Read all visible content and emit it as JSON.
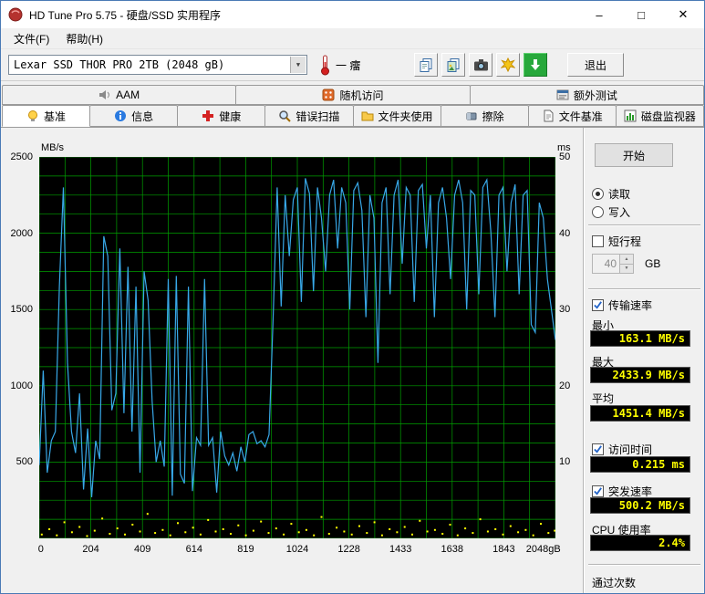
{
  "window": {
    "title": "HD Tune Pro 5.75 - 硬盘/SSD 实用程序",
    "minimize_glyph": "–",
    "maximize_glyph": "□",
    "close_glyph": "✕"
  },
  "menu": {
    "file": "文件(F)",
    "help": "帮助(H)"
  },
  "toolbar": {
    "device": "Lexar SSD THOR PRO 2TB (2048 gB)",
    "combo_arrow": "▼",
    "temperature": "一 癅",
    "exit_label": "退出"
  },
  "icons": {
    "spin_up": "▲",
    "spin_down": "▼"
  },
  "tabs": {
    "row1": [
      {
        "label": "AAM"
      },
      {
        "label": "随机访问"
      },
      {
        "label": "额外测试"
      }
    ],
    "row2": [
      {
        "label": "基准"
      },
      {
        "label": "信息"
      },
      {
        "label": "健康"
      },
      {
        "label": "错误扫描"
      },
      {
        "label": "文件夹使用"
      },
      {
        "label": "擦除"
      },
      {
        "label": "文件基准"
      },
      {
        "label": "磁盘监视器"
      }
    ]
  },
  "panel": {
    "start_label": "开始",
    "read_label": "读取",
    "write_label": "写入",
    "short_stroke_label": "短行程",
    "short_stroke_value": "40",
    "short_stroke_unit": "GB",
    "transfer_label": "传输速率",
    "min_label": "最小",
    "min_value": "163.1 MB/s",
    "max_label": "最大",
    "max_value": "2433.9 MB/s",
    "avg_label": "平均",
    "avg_value": "1451.4 MB/s",
    "access_label": "访问时间",
    "access_value": "0.215 ms",
    "burst_label": "突发速率",
    "burst_value": "500.2 MB/s",
    "cpu_label": "CPU 使用率",
    "cpu_value": "2.4%",
    "pass_label": "通过次数"
  },
  "colors": {
    "value_box_bg": "#000000",
    "value_box_text": "#ffff00",
    "chart_bg": "#000000",
    "grid_green": "#00a000",
    "transfer_line_blue": "#38a8e8",
    "access_dot_yellow": "#ffff00"
  },
  "chart_data": {
    "type": "line",
    "title": "",
    "left_axis": {
      "label": "MB/s",
      "min": 0,
      "max": 2500,
      "ticks": [
        500,
        1000,
        1500,
        2000,
        2500
      ]
    },
    "right_axis": {
      "label": "ms",
      "min": 0,
      "max": 50,
      "ticks": [
        10,
        20,
        30,
        40,
        50
      ]
    },
    "x_axis": {
      "min": 0,
      "max": 2048,
      "unit": "GB",
      "tick_labels": [
        "0",
        "204",
        "409",
        "614",
        "819",
        "1024",
        "1228",
        "1433",
        "1638",
        "1843",
        "2048gB"
      ]
    },
    "grid": {
      "color": "#00a000",
      "bg": "#000000",
      "x_divisions": 20,
      "y_divisions": 20
    },
    "legend": "none",
    "series": [
      {
        "name": "transfer_rate",
        "unit": "MB/s",
        "color": "#38a8e8",
        "style": "line",
        "points": [
          [
            0,
            480
          ],
          [
            16,
            1100
          ],
          [
            32,
            430
          ],
          [
            48,
            640
          ],
          [
            64,
            700
          ],
          [
            80,
            1650
          ],
          [
            96,
            2300
          ],
          [
            112,
            1150
          ],
          [
            128,
            700
          ],
          [
            144,
            560
          ],
          [
            160,
            950
          ],
          [
            176,
            320
          ],
          [
            192,
            720
          ],
          [
            208,
            270
          ],
          [
            224,
            640
          ],
          [
            240,
            520
          ],
          [
            256,
            1980
          ],
          [
            272,
            1850
          ],
          [
            288,
            840
          ],
          [
            304,
            950
          ],
          [
            320,
            1900
          ],
          [
            336,
            820
          ],
          [
            352,
            1780
          ],
          [
            368,
            700
          ],
          [
            384,
            1650
          ],
          [
            400,
            430
          ],
          [
            416,
            1750
          ],
          [
            432,
            1560
          ],
          [
            448,
            900
          ],
          [
            464,
            500
          ],
          [
            480,
            640
          ],
          [
            496,
            470
          ],
          [
            512,
            1700
          ],
          [
            528,
            280
          ],
          [
            544,
            1720
          ],
          [
            560,
            420
          ],
          [
            576,
            360
          ],
          [
            592,
            1650
          ],
          [
            608,
            310
          ],
          [
            624,
            660
          ],
          [
            640,
            610
          ],
          [
            656,
            1700
          ],
          [
            672,
            610
          ],
          [
            688,
            660
          ],
          [
            704,
            300
          ],
          [
            720,
            700
          ],
          [
            736,
            540
          ],
          [
            752,
            480
          ],
          [
            768,
            560
          ],
          [
            784,
            440
          ],
          [
            800,
            600
          ],
          [
            816,
            500
          ],
          [
            832,
            680
          ],
          [
            848,
            700
          ],
          [
            864,
            620
          ],
          [
            880,
            640
          ],
          [
            896,
            600
          ],
          [
            912,
            680
          ],
          [
            928,
            1450
          ],
          [
            944,
            2300
          ],
          [
            960,
            1520
          ],
          [
            976,
            2250
          ],
          [
            992,
            1850
          ],
          [
            1008,
            2220
          ],
          [
            1024,
            2300
          ],
          [
            1040,
            1550
          ],
          [
            1056,
            2360
          ],
          [
            1072,
            2260
          ],
          [
            1088,
            1620
          ],
          [
            1104,
            2300
          ],
          [
            1120,
            2100
          ],
          [
            1136,
            1750
          ],
          [
            1152,
            2250
          ],
          [
            1168,
            2350
          ],
          [
            1184,
            1900
          ],
          [
            1200,
            2300
          ],
          [
            1216,
            2200
          ],
          [
            1232,
            1500
          ],
          [
            1248,
            2280
          ],
          [
            1264,
            2330
          ],
          [
            1280,
            2150
          ],
          [
            1296,
            1450
          ],
          [
            1312,
            2250
          ],
          [
            1328,
            2100
          ],
          [
            1344,
            1150
          ],
          [
            1360,
            2200
          ],
          [
            1376,
            2300
          ],
          [
            1392,
            1600
          ],
          [
            1408,
            2250
          ],
          [
            1424,
            2350
          ],
          [
            1440,
            1800
          ],
          [
            1456,
            2300
          ],
          [
            1472,
            2250
          ],
          [
            1488,
            1550
          ],
          [
            1504,
            2280
          ],
          [
            1520,
            2320
          ],
          [
            1536,
            1900
          ],
          [
            1552,
            2250
          ],
          [
            1568,
            1450
          ],
          [
            1584,
            2200
          ],
          [
            1600,
            2300
          ],
          [
            1616,
            2100
          ],
          [
            1632,
            1700
          ],
          [
            1648,
            2250
          ],
          [
            1664,
            2350
          ],
          [
            1680,
            2200
          ],
          [
            1696,
            1500
          ],
          [
            1712,
            2280
          ],
          [
            1728,
            2250
          ],
          [
            1744,
            1600
          ],
          [
            1760,
            2300
          ],
          [
            1776,
            2350
          ],
          [
            1792,
            2000
          ],
          [
            1808,
            1450
          ],
          [
            1824,
            2250
          ],
          [
            1840,
            2300
          ],
          [
            1856,
            1750
          ],
          [
            1872,
            2200
          ],
          [
            1888,
            2320
          ],
          [
            1904,
            1600
          ],
          [
            1920,
            2250
          ],
          [
            1936,
            2280
          ],
          [
            1952,
            1400
          ],
          [
            1968,
            1350
          ],
          [
            1984,
            2200
          ],
          [
            2000,
            2100
          ],
          [
            2016,
            1700
          ],
          [
            2032,
            1500
          ],
          [
            2048,
            1300
          ]
        ]
      },
      {
        "name": "access_time",
        "unit": "ms",
        "color": "#ffff00",
        "style": "scatter",
        "points": [
          [
            10,
            0.5
          ],
          [
            40,
            1.2
          ],
          [
            70,
            0.4
          ],
          [
            100,
            2.1
          ],
          [
            130,
            0.8
          ],
          [
            160,
            1.5
          ],
          [
            190,
            0.3
          ],
          [
            220,
            1.0
          ],
          [
            250,
            2.6
          ],
          [
            280,
            0.6
          ],
          [
            310,
            1.3
          ],
          [
            340,
            0.5
          ],
          [
            370,
            1.8
          ],
          [
            400,
            0.9
          ],
          [
            430,
            3.2
          ],
          [
            460,
            0.7
          ],
          [
            490,
            1.1
          ],
          [
            520,
            0.4
          ],
          [
            550,
            2.0
          ],
          [
            580,
            0.8
          ],
          [
            610,
            1.4
          ],
          [
            640,
            0.5
          ],
          [
            670,
            2.4
          ],
          [
            700,
            0.9
          ],
          [
            730,
            1.2
          ],
          [
            760,
            0.6
          ],
          [
            790,
            1.7
          ],
          [
            820,
            0.4
          ],
          [
            850,
            1.0
          ],
          [
            880,
            2.2
          ],
          [
            910,
            0.7
          ],
          [
            940,
            1.3
          ],
          [
            970,
            0.5
          ],
          [
            1000,
            1.9
          ],
          [
            1030,
            0.8
          ],
          [
            1060,
            1.1
          ],
          [
            1090,
            0.4
          ],
          [
            1120,
            2.8
          ],
          [
            1150,
            0.6
          ],
          [
            1180,
            1.4
          ],
          [
            1210,
            0.9
          ],
          [
            1240,
            0.5
          ],
          [
            1270,
            1.6
          ],
          [
            1300,
            0.7
          ],
          [
            1330,
            2.1
          ],
          [
            1360,
            0.4
          ],
          [
            1390,
            1.2
          ],
          [
            1420,
            0.8
          ],
          [
            1450,
            1.5
          ],
          [
            1480,
            0.5
          ],
          [
            1510,
            2.3
          ],
          [
            1540,
            0.9
          ],
          [
            1570,
            1.1
          ],
          [
            1600,
            0.6
          ],
          [
            1630,
            1.8
          ],
          [
            1660,
            0.4
          ],
          [
            1690,
            1.3
          ],
          [
            1720,
            0.7
          ],
          [
            1750,
            2.5
          ],
          [
            1780,
            0.9
          ],
          [
            1810,
            1.2
          ],
          [
            1840,
            0.5
          ],
          [
            1870,
            1.6
          ],
          [
            1900,
            0.8
          ],
          [
            1930,
            1.1
          ],
          [
            1960,
            0.4
          ],
          [
            1990,
            1.9
          ],
          [
            2020,
            0.7
          ],
          [
            2045,
            1.0
          ]
        ]
      }
    ],
    "summary": {
      "min_mbs": 163.1,
      "max_mbs": 2433.9,
      "avg_mbs": 1451.4,
      "access_ms": 0.215,
      "burst_mbs": 500.2,
      "cpu_pct": 2.4
    }
  }
}
